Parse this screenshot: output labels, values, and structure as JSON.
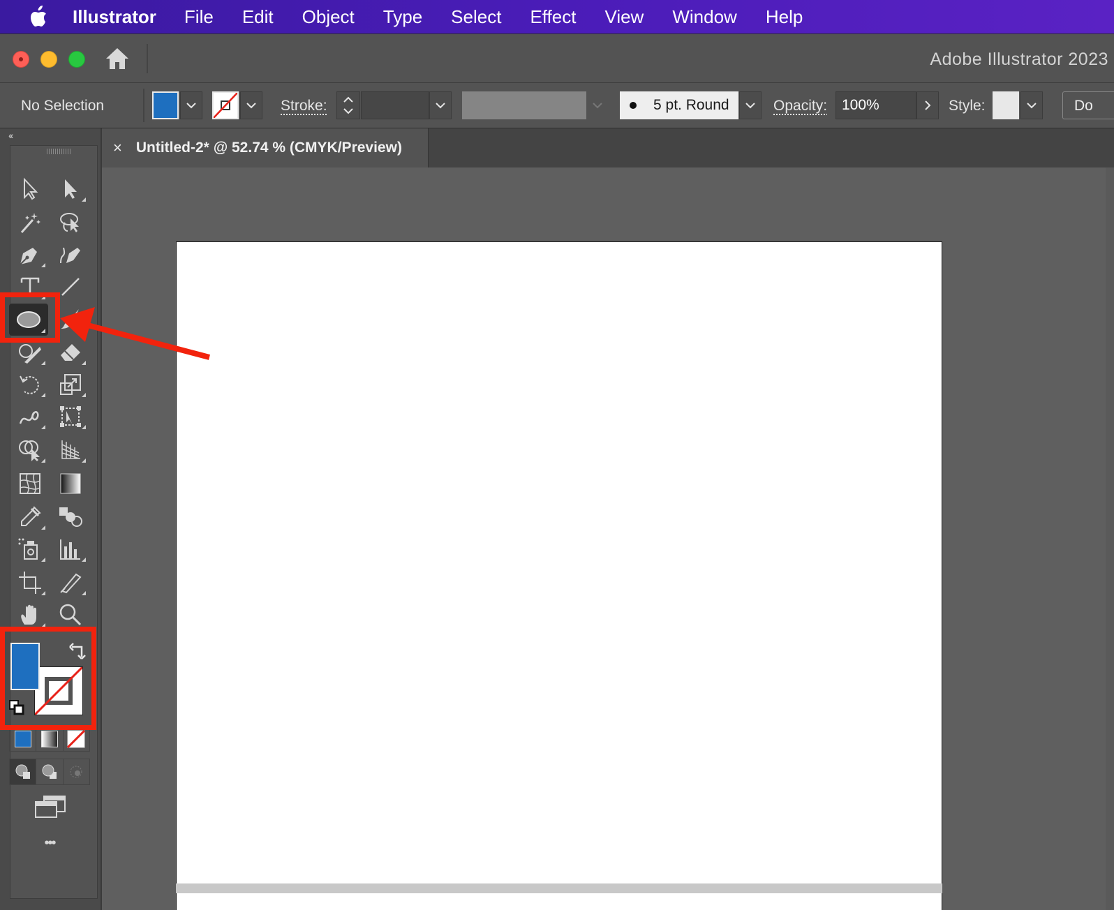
{
  "menubar": {
    "app_name": "Illustrator",
    "items": [
      "File",
      "Edit",
      "Object",
      "Type",
      "Select",
      "Effect",
      "View",
      "Window",
      "Help"
    ]
  },
  "titlebar": {
    "title": "Adobe Illustrator 2023"
  },
  "control_bar": {
    "selection_status": "No Selection",
    "fill_color": "#1e6fbf",
    "stroke_label": "Stroke:",
    "brush_label": "5 pt. Round",
    "opacity_label": "Opacity:",
    "opacity_value": "100%",
    "style_label": "Style:",
    "doc_setup_label": "Do"
  },
  "document": {
    "tab_title": "Untitled-2* @ 52.74 % (CMYK/Preview)",
    "close_glyph": "×"
  },
  "toolbar": {
    "collapse_glyph": "‹‹",
    "active_tool": "ellipse-tool",
    "fill_color": "#1e6fbf",
    "stroke": "none",
    "more_glyph": "•••"
  },
  "colors": {
    "accent": "#1e6fbf",
    "annotation": "#f2230d",
    "none_slash": "#e8221a"
  }
}
